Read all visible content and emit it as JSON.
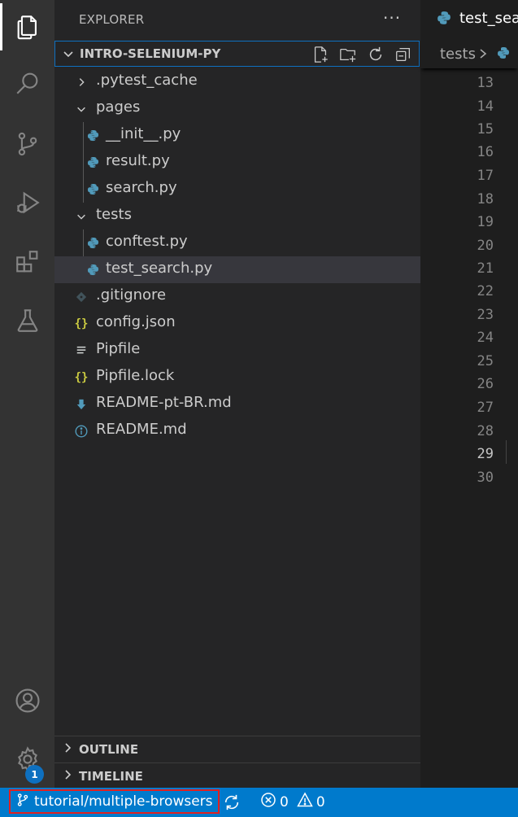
{
  "explorer": {
    "title": "EXPLORER",
    "more_label": "···",
    "project_name": "INTRO-SELENIUM-PY",
    "tree": [
      {
        "label": ".pytest_cache",
        "kind": "folder",
        "expanded": false
      },
      {
        "label": "pages",
        "kind": "folder",
        "expanded": true
      },
      {
        "label": "__init__.py",
        "kind": "python"
      },
      {
        "label": "result.py",
        "kind": "python"
      },
      {
        "label": "search.py",
        "kind": "python"
      },
      {
        "label": "tests",
        "kind": "folder",
        "expanded": true
      },
      {
        "label": "conftest.py",
        "kind": "python"
      },
      {
        "label": "test_search.py",
        "kind": "python",
        "selected": true
      },
      {
        "label": ".gitignore",
        "kind": "git"
      },
      {
        "label": "config.json",
        "kind": "json"
      },
      {
        "label": "Pipfile",
        "kind": "text"
      },
      {
        "label": "Pipfile.lock",
        "kind": "json"
      },
      {
        "label": "README-pt-BR.md",
        "kind": "markdown"
      },
      {
        "label": "README.md",
        "kind": "info"
      }
    ],
    "outline_label": "OUTLINE",
    "timeline_label": "TIMELINE"
  },
  "editor": {
    "tab_label": "test_search.py",
    "breadcrumb_folder": "tests",
    "line_numbers": [
      "13",
      "14",
      "15",
      "16",
      "17",
      "18",
      "19",
      "20",
      "21",
      "22",
      "23",
      "24",
      "25",
      "26",
      "27",
      "28",
      "29",
      "30"
    ],
    "current_line": "29"
  },
  "activity_bar": {
    "account_badge": "1"
  },
  "status_bar": {
    "branch": "tutorial/multiple-browsers",
    "errors": "0",
    "warnings": "0"
  },
  "colors": {
    "accent": "#007acc",
    "python_icon": "#519aba",
    "json_icon": "#cbcb41",
    "selection": "#37373d",
    "highlight_border": "#e02020"
  }
}
